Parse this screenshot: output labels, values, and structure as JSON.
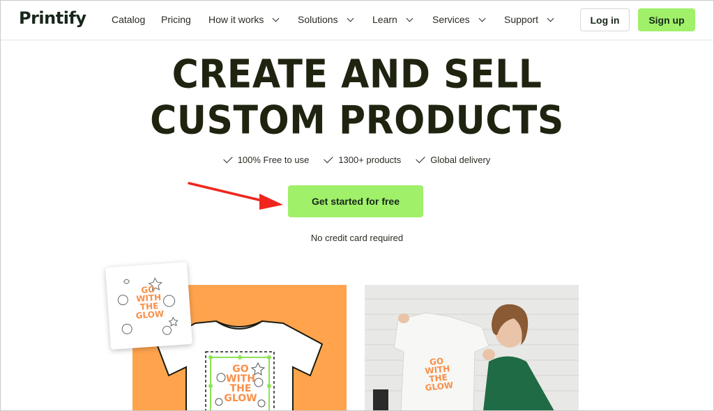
{
  "brand": {
    "logo": "Printify",
    "accent": "#a0f06a",
    "dark": "#1f2410",
    "orange": "#ffa44d"
  },
  "nav": {
    "items": [
      {
        "label": "Catalog",
        "dropdown": false
      },
      {
        "label": "Pricing",
        "dropdown": false
      },
      {
        "label": "How it works",
        "dropdown": true
      },
      {
        "label": "Solutions",
        "dropdown": true
      },
      {
        "label": "Learn",
        "dropdown": true
      },
      {
        "label": "Services",
        "dropdown": true
      },
      {
        "label": "Support",
        "dropdown": true
      }
    ],
    "login": "Log in",
    "signup": "Sign up"
  },
  "hero": {
    "line1": "CREATE AND SELL",
    "line2": "CUSTOM PRODUCTS",
    "features": [
      "100% Free to use",
      "1300+ products",
      "Global delivery"
    ],
    "cta": "Get started for free",
    "note": "No credit card required"
  },
  "design": {
    "text_lines": [
      "GO",
      "WITH",
      "THE",
      "GLOW"
    ]
  }
}
